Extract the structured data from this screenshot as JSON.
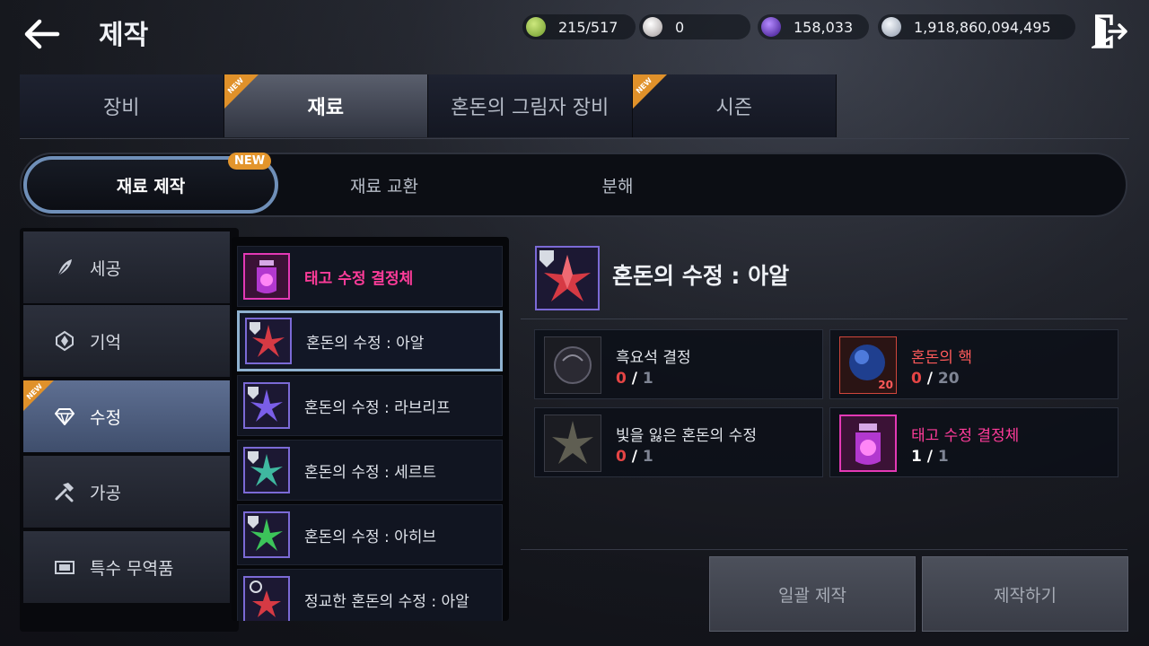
{
  "header": {
    "title": "제작",
    "currencies": [
      {
        "icon": "energy-icon",
        "value": "215/517",
        "color": "#8fc24a"
      },
      {
        "icon": "pearl-icon",
        "value": "0",
        "color": "#d9d3d3"
      },
      {
        "icon": "chaos-orb-icon",
        "value": "158,033",
        "color": "#6a3bd0"
      },
      {
        "icon": "silver-coin-icon",
        "value": "1,918,860,094,495",
        "color": "#bfc6d4"
      }
    ]
  },
  "main_tabs": [
    {
      "label": "장비",
      "active": false,
      "new": false
    },
    {
      "label": "재료",
      "active": true,
      "new": true
    },
    {
      "label": "혼돈의 그림자 장비",
      "active": false,
      "new": false
    },
    {
      "label": "시즌",
      "active": false,
      "new": true
    }
  ],
  "new_badge": "NEW",
  "sub_tabs": [
    {
      "label": "재료 제작",
      "active": true,
      "new_label": "NEW"
    },
    {
      "label": "재료 교환",
      "active": false
    },
    {
      "label": "분해",
      "active": false
    }
  ],
  "categories": [
    {
      "label": "세공",
      "icon": "feather-icon",
      "active": false
    },
    {
      "label": "기억",
      "icon": "crest-icon",
      "active": false
    },
    {
      "label": "수정",
      "icon": "diamond-icon",
      "active": true,
      "new": true
    },
    {
      "label": "가공",
      "icon": "hammer-icon",
      "active": false
    },
    {
      "label": "특수 무역품",
      "icon": "trade-goods-icon",
      "active": false
    }
  ],
  "items": [
    {
      "label": "태고 수정 결정체",
      "rarity": "legendary",
      "selected": false
    },
    {
      "label": "혼돈의 수정 : 아알",
      "rarity": "epic",
      "selected": true
    },
    {
      "label": "혼돈의 수정 : 라브리프",
      "rarity": "epic",
      "selected": false
    },
    {
      "label": "혼돈의 수정 : 세르트",
      "rarity": "epic",
      "selected": false
    },
    {
      "label": "혼돈의 수정 : 아히브",
      "rarity": "epic",
      "selected": false
    },
    {
      "label": "정교한 혼돈의 수정 : 아알",
      "rarity": "epic",
      "selected": false
    }
  ],
  "detail": {
    "title": "혼돈의 수정 : 아알",
    "materials": [
      {
        "name": "흑요석 결정",
        "have": "0",
        "need": "1",
        "name_color": "normal"
      },
      {
        "name": "혼돈의 핵",
        "have": "0",
        "need": "20",
        "name_color": "red",
        "badge": "20"
      },
      {
        "name": "빛을 잃은 혼돈의 수정",
        "have": "0",
        "need": "1",
        "name_color": "normal"
      },
      {
        "name": "태고 수정 결정체",
        "have": "1",
        "need": "1",
        "name_color": "pink"
      }
    ],
    "separator": "/"
  },
  "buttons": {
    "bulk_craft": "일괄 제작",
    "craft": "제작하기"
  },
  "colors": {
    "accent_new": "#e3952c",
    "legendary": "#ff3c9a",
    "missing": "#e54545",
    "selected_border": "#8fb2d0"
  }
}
